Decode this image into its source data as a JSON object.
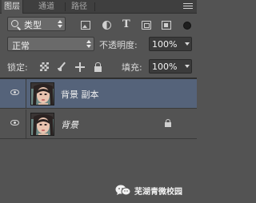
{
  "tabs": [
    {
      "label": "图层",
      "active": true
    },
    {
      "label": "通道",
      "active": false
    },
    {
      "label": "路径",
      "active": false
    }
  ],
  "filter": {
    "kind_label": "类型",
    "icons": [
      "image-filter-icon",
      "adjustment-filter-icon",
      "type-filter-icon",
      "shape-filter-icon",
      "smart-object-filter-icon"
    ],
    "text_icon_glyph": "T"
  },
  "blend": {
    "mode": "正常",
    "opacity_label": "不透明度:",
    "opacity_value": "100%"
  },
  "locks": {
    "label": "锁定:",
    "fill_label": "填充:",
    "fill_value": "100%"
  },
  "layers": [
    {
      "name": "背景 副本",
      "selected": true,
      "visible": true,
      "locked": false,
      "italic": false
    },
    {
      "name": "背景",
      "selected": false,
      "visible": true,
      "locked": true,
      "italic": true
    }
  ],
  "watermark": {
    "text": "芜湖青微校园"
  },
  "colors": {
    "panel_bg": "#535353",
    "selected_row": "#55637a",
    "tabbar_bg": "#3f3f3f"
  }
}
